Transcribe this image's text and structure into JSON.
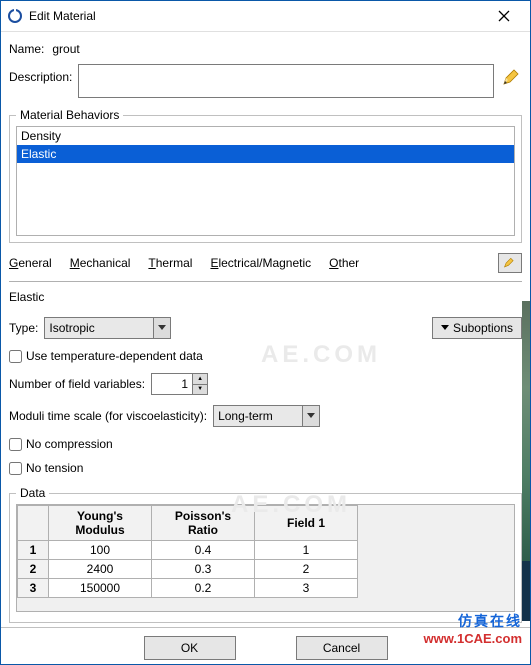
{
  "window": {
    "title": "Edit Material"
  },
  "name": {
    "label": "Name:",
    "value": "grout"
  },
  "description": {
    "label": "Description:",
    "value": ""
  },
  "behaviors": {
    "legend": "Material Behaviors",
    "items": [
      {
        "label": "Density",
        "selected": false
      },
      {
        "label": "Elastic",
        "selected": true
      }
    ]
  },
  "menus": {
    "general": "General",
    "mechanical": "Mechanical",
    "thermal": "Thermal",
    "electrical": "Electrical/Magnetic",
    "other": "Other"
  },
  "section": {
    "title": "Elastic"
  },
  "type": {
    "label": "Type:",
    "value": "Isotropic"
  },
  "suboptions": {
    "label": "Suboptions"
  },
  "temp_dep": {
    "label": "Use temperature-dependent data",
    "checked": false
  },
  "field_vars": {
    "label": "Number of field variables:",
    "value": "1"
  },
  "moduli": {
    "label": "Moduli time scale (for viscoelasticity):",
    "value": "Long-term"
  },
  "no_compression": {
    "label": "No compression",
    "checked": false
  },
  "no_tension": {
    "label": "No tension",
    "checked": false
  },
  "data": {
    "legend": "Data",
    "headers": [
      "Young's Modulus",
      "Poisson's Ratio",
      "Field 1"
    ],
    "rows": [
      {
        "n": "1",
        "ym": "100",
        "pr": "0.4",
        "f1": "1"
      },
      {
        "n": "2",
        "ym": "2400",
        "pr": "0.3",
        "f1": "2"
      },
      {
        "n": "3",
        "ym": "150000",
        "pr": "0.2",
        "f1": "3"
      }
    ]
  },
  "buttons": {
    "ok": "OK",
    "cancel": "Cancel"
  },
  "watermark": {
    "cn": "仿真在线",
    "url": "www.1CAE.com"
  },
  "faint_wm": "AE.COM",
  "chart_data": {
    "type": "table",
    "title": "Elastic",
    "columns": [
      "Young's Modulus",
      "Poisson's Ratio",
      "Field 1"
    ],
    "rows": [
      [
        100,
        0.4,
        1
      ],
      [
        2400,
        0.3,
        2
      ],
      [
        150000,
        0.2,
        3
      ]
    ]
  }
}
